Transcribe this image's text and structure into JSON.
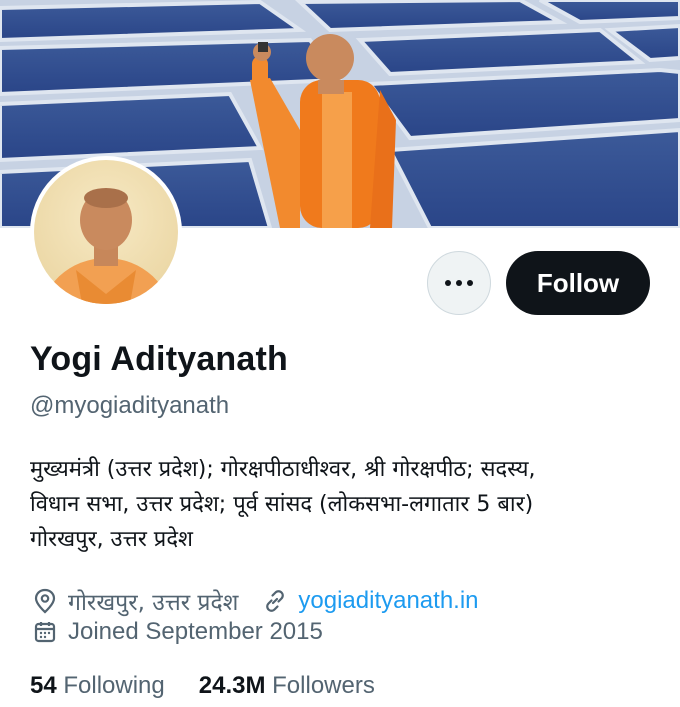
{
  "profile": {
    "name": "Yogi Adityanath",
    "handle": "@myogiadityanath",
    "bio_lines": [
      "मुख्यमंत्री (उत्तर प्रदेश); गोरक्षपीठाधीश्वर, श्री गोरक्षपीठ; सदस्य,",
      "विधान सभा, उत्तर प्रदेश; पूर्व सांसद (लोकसभा-लगातार 5 बार)",
      "गोरखपुर, उत्तर प्रदेश"
    ],
    "location": "गोरखपुर, उत्तर प्रदेश",
    "website": "yogiadityanath.in",
    "joined": "Joined September 2015"
  },
  "stats": {
    "following_count": "54",
    "following_label": "Following",
    "followers_count": "24.3M",
    "followers_label": "Followers"
  },
  "actions": {
    "follow_label": "Follow",
    "more_icon": "more-horizontal-icon"
  },
  "colors": {
    "accent": "#1d9bf0",
    "follow_bg": "#0f1419",
    "secondary_text": "#536471",
    "robe": "#f07a1c"
  }
}
